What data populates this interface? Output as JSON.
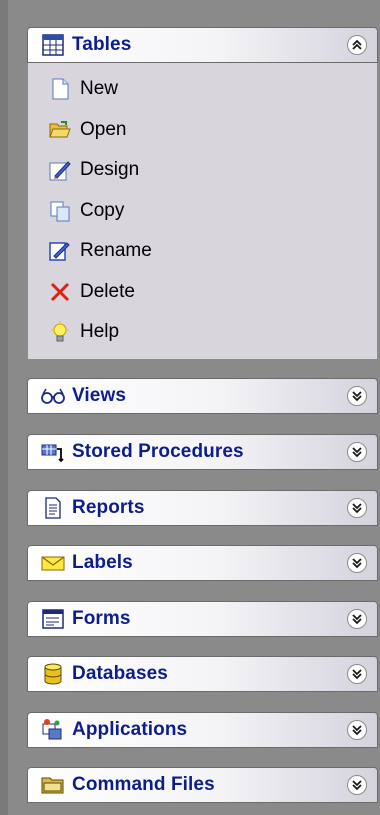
{
  "sections": [
    {
      "title": "Tables",
      "icon": "table-grid-icon",
      "expanded": true,
      "items": [
        {
          "label": "New",
          "icon": "new-document-icon"
        },
        {
          "label": "Open",
          "icon": "open-folder-icon"
        },
        {
          "label": "Design",
          "icon": "design-pencil-icon"
        },
        {
          "label": "Copy",
          "icon": "copy-icon"
        },
        {
          "label": "Rename",
          "icon": "rename-icon"
        },
        {
          "label": "Delete",
          "icon": "delete-x-icon"
        },
        {
          "label": "Help",
          "icon": "help-lightbulb-icon"
        }
      ]
    },
    {
      "title": "Views",
      "icon": "glasses-icon",
      "expanded": false
    },
    {
      "title": "Stored Procedures",
      "icon": "stored-procedure-icon",
      "expanded": false
    },
    {
      "title": "Reports",
      "icon": "report-document-icon",
      "expanded": false
    },
    {
      "title": "Labels",
      "icon": "envelope-icon",
      "expanded": false
    },
    {
      "title": "Forms",
      "icon": "form-icon",
      "expanded": false
    },
    {
      "title": "Databases",
      "icon": "database-cylinder-icon",
      "expanded": false
    },
    {
      "title": "Applications",
      "icon": "applications-icon",
      "expanded": false
    },
    {
      "title": "Command Files",
      "icon": "command-folder-icon",
      "expanded": false
    }
  ],
  "colors": {
    "header_text": "#0c1e8c",
    "panel_bg": "#8a8a8a",
    "list_bg": "#d8d5dc"
  }
}
